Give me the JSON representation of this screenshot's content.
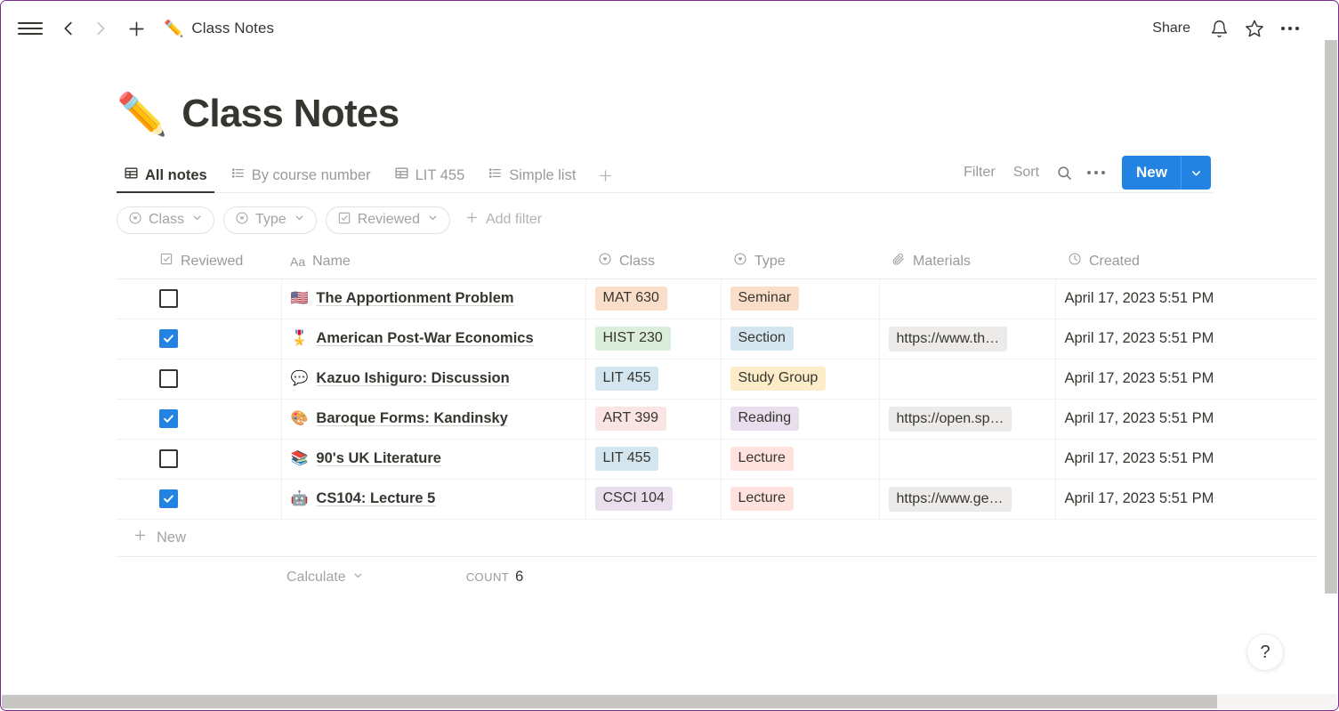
{
  "topbar": {
    "menu_icon": "hamburger-icon",
    "back_icon": "chevron-left-icon",
    "forward_icon": "chevron-right-icon",
    "add_icon": "plus-icon",
    "breadcrumb_emoji": "✏️",
    "breadcrumb_label": "Class Notes",
    "share_label": "Share",
    "notification_icon": "bell-icon",
    "favorite_icon": "star-icon",
    "more_icon": "more-horizontal-icon"
  },
  "page": {
    "emoji": "✏️",
    "title": "Class Notes"
  },
  "views": {
    "tabs": [
      {
        "label": "All notes",
        "icon": "table-icon",
        "active": true
      },
      {
        "label": "By course number",
        "icon": "list-icon",
        "active": false
      },
      {
        "label": "LIT 455",
        "icon": "table-icon",
        "active": false
      },
      {
        "label": "Simple list",
        "icon": "list-icon",
        "active": false
      }
    ],
    "add_view_icon": "plus-icon",
    "filter_label": "Filter",
    "sort_label": "Sort",
    "search_icon": "search-icon",
    "more_icon": "more-horizontal-icon",
    "new_label": "New",
    "new_caret_icon": "chevron-down-icon",
    "new_button_color": "#2383e2"
  },
  "filters": {
    "chips": [
      {
        "label": "Class",
        "icon": "select-icon"
      },
      {
        "label": "Type",
        "icon": "select-icon"
      },
      {
        "label": "Reviewed",
        "icon": "checkbox-icon"
      }
    ],
    "add_filter_label": "Add filter",
    "add_filter_icon": "plus-icon"
  },
  "table": {
    "columns": [
      {
        "label": "Reviewed",
        "icon": "checkbox-icon"
      },
      {
        "label": "Name",
        "icon": "title-aa-icon"
      },
      {
        "label": "Class",
        "icon": "select-icon"
      },
      {
        "label": "Type",
        "icon": "select-icon"
      },
      {
        "label": "Materials",
        "icon": "paperclip-icon"
      },
      {
        "label": "Created",
        "icon": "clock-icon"
      }
    ],
    "rows": [
      {
        "reviewed": false,
        "emoji": "🇺🇸",
        "name": "The Apportionment Problem",
        "class": "MAT 630",
        "class_color": "orange",
        "type": "Seminar",
        "type_color": "orange",
        "materials": "",
        "created": "April 17, 2023 5:51 PM"
      },
      {
        "reviewed": true,
        "emoji": "🎖️",
        "name": "American Post-War Economics",
        "class": "HIST 230",
        "class_color": "green",
        "type": "Section",
        "type_color": "blue",
        "materials": "https://www.th…",
        "created": "April 17, 2023 5:51 PM"
      },
      {
        "reviewed": false,
        "emoji": "💬",
        "name": "Kazuo Ishiguro: Discussion",
        "class": "LIT 455",
        "class_color": "blue",
        "type": "Study Group",
        "type_color": "yellow",
        "materials": "",
        "created": "April 17, 2023 5:51 PM"
      },
      {
        "reviewed": true,
        "emoji": "🎨",
        "name": "Baroque Forms: Kandinsky",
        "class": "ART 399",
        "class_color": "pink",
        "type": "Reading",
        "type_color": "purple",
        "materials": "https://open.sp…",
        "created": "April 17, 2023 5:51 PM"
      },
      {
        "reviewed": false,
        "emoji": "📚",
        "name": "90's UK Literature",
        "class": "LIT 455",
        "class_color": "blue",
        "type": "Lecture",
        "type_color": "red",
        "materials": "",
        "created": "April 17, 2023 5:51 PM"
      },
      {
        "reviewed": true,
        "emoji": "🤖",
        "name": "CS104: Lecture 5",
        "class": "CSCI 104",
        "class_color": "purple",
        "type": "Lecture",
        "type_color": "red",
        "materials": "https://www.ge…",
        "created": "April 17, 2023 5:51 PM"
      }
    ],
    "new_row_label": "New",
    "new_row_icon": "plus-icon"
  },
  "footer": {
    "calculate_label": "Calculate",
    "calculate_caret_icon": "chevron-down-icon",
    "count_label": "COUNT",
    "count_value": "6"
  },
  "help": {
    "label": "?"
  },
  "tag_colors": {
    "orange": "#fadec9",
    "green": "#dbeddb",
    "blue": "#d3e5ef",
    "pink": "#fbe4e4",
    "purple": "#e8deee",
    "yellow": "#fdecc8",
    "red": "#ffe2dd"
  }
}
